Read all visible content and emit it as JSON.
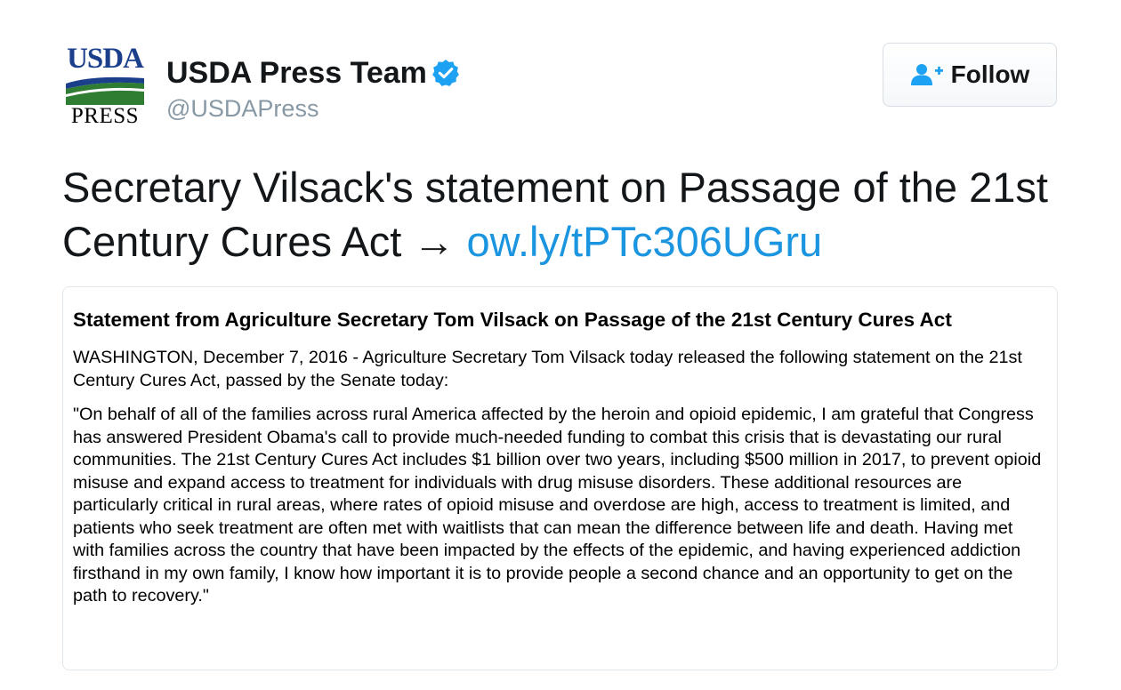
{
  "account": {
    "logo_top_text": "USDA",
    "logo_bottom_text": "PRESS",
    "display_name": "USDA Press Team",
    "handle": "@USDAPress",
    "verified": true
  },
  "follow_button": {
    "label": "Follow",
    "icon": "add-user-icon"
  },
  "tweet": {
    "text_prefix": "Secretary Vilsack's statement on Passage of the 21st Century Cures Act → ",
    "link_text": "ow.ly/tPTc306UGru"
  },
  "card": {
    "title": "Statement from Agriculture Secretary Tom Vilsack on Passage of the 21st Century Cures Act",
    "paragraph_1": "WASHINGTON, December 7, 2016 - Agriculture Secretary Tom Vilsack today released the following statement on the 21st Century Cures Act, passed by the Senate today:",
    "paragraph_2": "\"On behalf of all of the families across rural America affected by the heroin and opioid epidemic, I am grateful that Congress has answered President Obama's call to provide much-needed funding to combat this crisis that is devastating our rural communities. The 21st Century Cures Act includes $1 billion over two years, including $500 million in 2017, to prevent opioid misuse and expand access to treatment for individuals with drug misuse disorders. These additional resources are particularly critical in rural areas, where rates of opioid misuse and overdose are high, access to treatment is limited, and patients who seek treatment are often met with waitlists that can mean the difference between life and death. Having met with families across the country that have been impacted by the effects of the epidemic, and having experienced addiction firsthand in my own family, I know how important it is to provide people a second chance and an opportunity to get on the path to recovery.\""
  },
  "colors": {
    "link": "#1b95e0",
    "verified_badge": "#1da1f2",
    "handle": "#8899a6",
    "usda_blue": "#1b3f8b",
    "usda_green": "#2e7d32"
  }
}
